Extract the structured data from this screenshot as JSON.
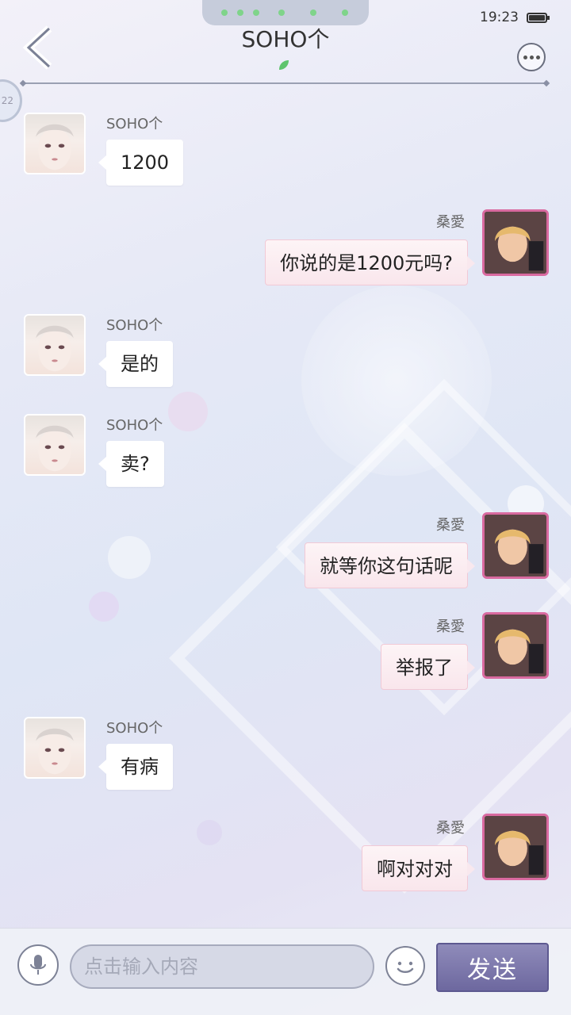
{
  "status_bar": {
    "time": "19:23"
  },
  "header": {
    "title": "SOHO个",
    "side_badge": "22"
  },
  "messages": [
    {
      "side": "left",
      "sender": "SOHO个",
      "text": "1200"
    },
    {
      "side": "right",
      "sender": "桑愛",
      "text": "你说的是1200元吗?"
    },
    {
      "side": "left",
      "sender": "SOHO个",
      "text": "是的"
    },
    {
      "side": "left",
      "sender": "SOHO个",
      "text": "卖?"
    },
    {
      "side": "right",
      "sender": "桑愛",
      "text": "就等你这句话呢"
    },
    {
      "side": "right",
      "sender": "桑愛",
      "text": "举报了"
    },
    {
      "side": "left",
      "sender": "SOHO个",
      "text": "有病"
    },
    {
      "side": "right",
      "sender": "桑愛",
      "text": "啊对对对"
    }
  ],
  "input": {
    "placeholder": "点击输入内容",
    "send_label": "发送"
  },
  "icons": {
    "back": "back-arrow-icon",
    "more": "more-icon",
    "leaf": "leaf-icon",
    "mic": "microphone-icon",
    "emoji": "emoji-icon",
    "battery": "battery-icon"
  },
  "colors": {
    "send_button": "#7a76aa",
    "accent_pink": "#d96aa0",
    "leaf_green": "#5fc46d"
  }
}
